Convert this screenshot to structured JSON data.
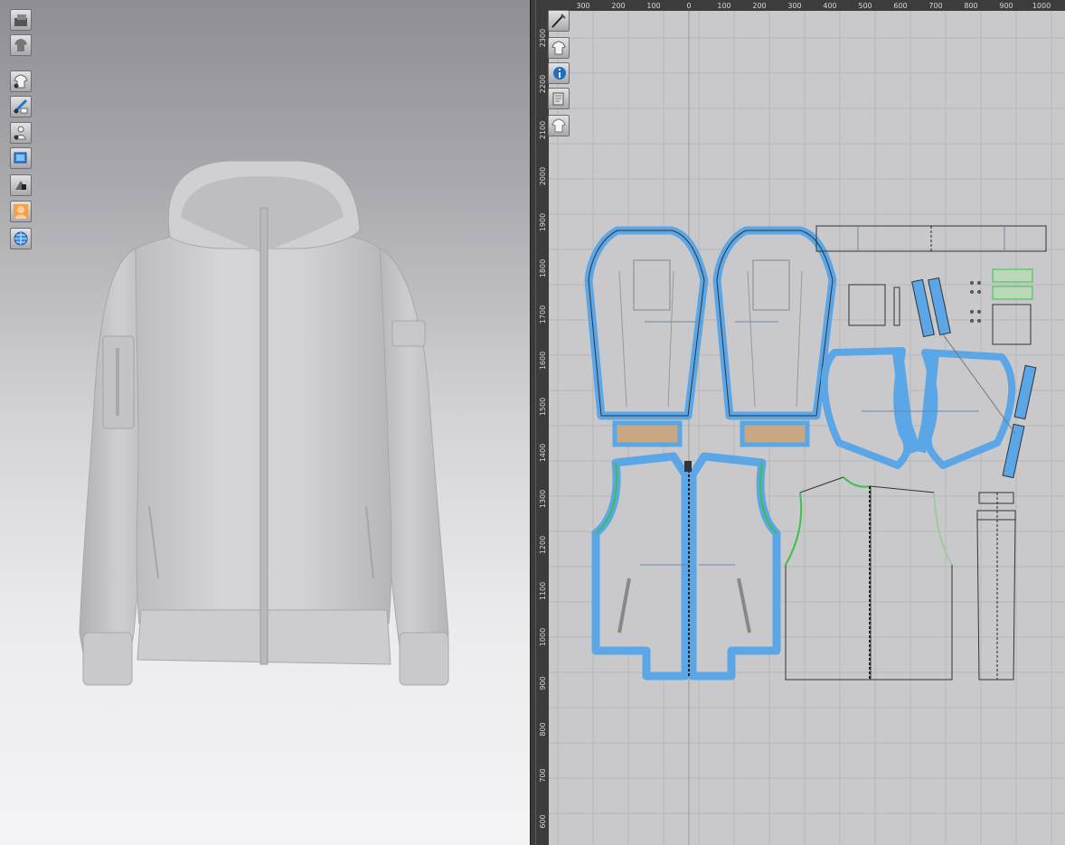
{
  "view3d": {
    "toolbar": [
      {
        "name": "render-icon"
      },
      {
        "name": "garment-display-icon"
      },
      {
        "name": "show-garment-icon"
      },
      {
        "name": "show-pattern-edit-icon"
      },
      {
        "name": "show-avatar-icon"
      },
      {
        "name": "show-fabric-icon"
      },
      {
        "name": "show-shading-icon"
      },
      {
        "name": "avatar-display-icon"
      },
      {
        "name": "environment-icon"
      }
    ]
  },
  "view2d": {
    "toolbar": [
      {
        "name": "pattern-edit-icon"
      },
      {
        "name": "pattern-display-icon"
      },
      {
        "name": "info-icon"
      },
      {
        "name": "sheet-icon"
      },
      {
        "name": "garment-2d-icon"
      }
    ],
    "ruler_top": [
      "300",
      "200",
      "100",
      "0",
      "100",
      "200",
      "300",
      "400",
      "500",
      "600",
      "700",
      "800",
      "900",
      "1000"
    ],
    "ruler_left": [
      "2300",
      "2200",
      "2100",
      "2000",
      "1900",
      "1800",
      "1700",
      "1600",
      "1500",
      "1400",
      "1300",
      "1200",
      "1100",
      "1000",
      "900",
      "800",
      "700",
      "600"
    ]
  },
  "colors": {
    "selection_blue": "#5aa6e6",
    "seam_green": "#39c24a",
    "cuff_tan": "#c8a882",
    "grid_line": "#b5b5b8",
    "background_2d": "#c9c9cb"
  }
}
